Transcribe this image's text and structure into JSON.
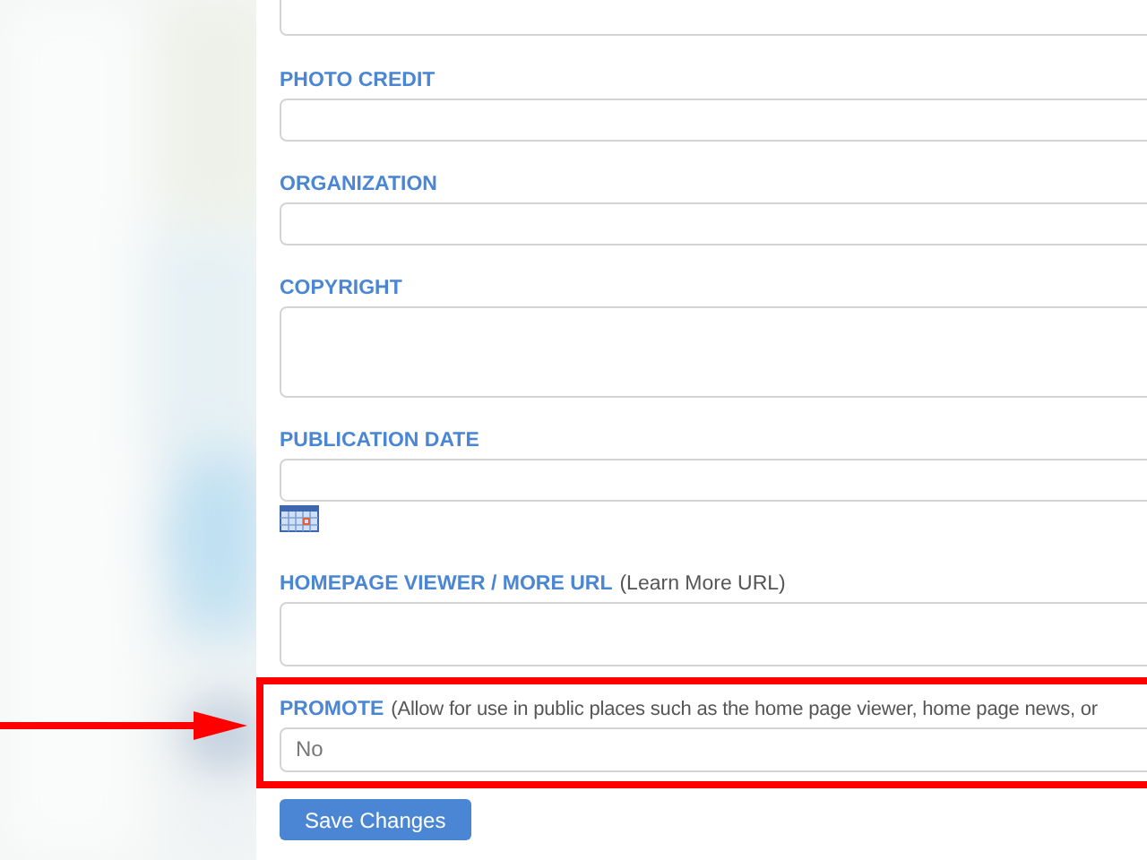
{
  "form": {
    "fields": [
      {
        "kind": "input"
      },
      {
        "kind": "input",
        "label": "PHOTO CREDIT"
      },
      {
        "kind": "input",
        "label": "ORGANIZATION"
      },
      {
        "kind": "textarea",
        "label": "COPYRIGHT"
      },
      {
        "kind": "date",
        "label": "PUBLICATION DATE"
      },
      {
        "kind": "tall",
        "label": "HOMEPAGE VIEWER / MORE URL",
        "note": "(Learn More URL)"
      },
      {
        "kind": "select",
        "label": "PROMOTE",
        "note": "(Allow for use in public places such as the home page viewer, home page news, or",
        "value": "No",
        "highlighted": true
      }
    ],
    "save_button": "Save Changes"
  }
}
